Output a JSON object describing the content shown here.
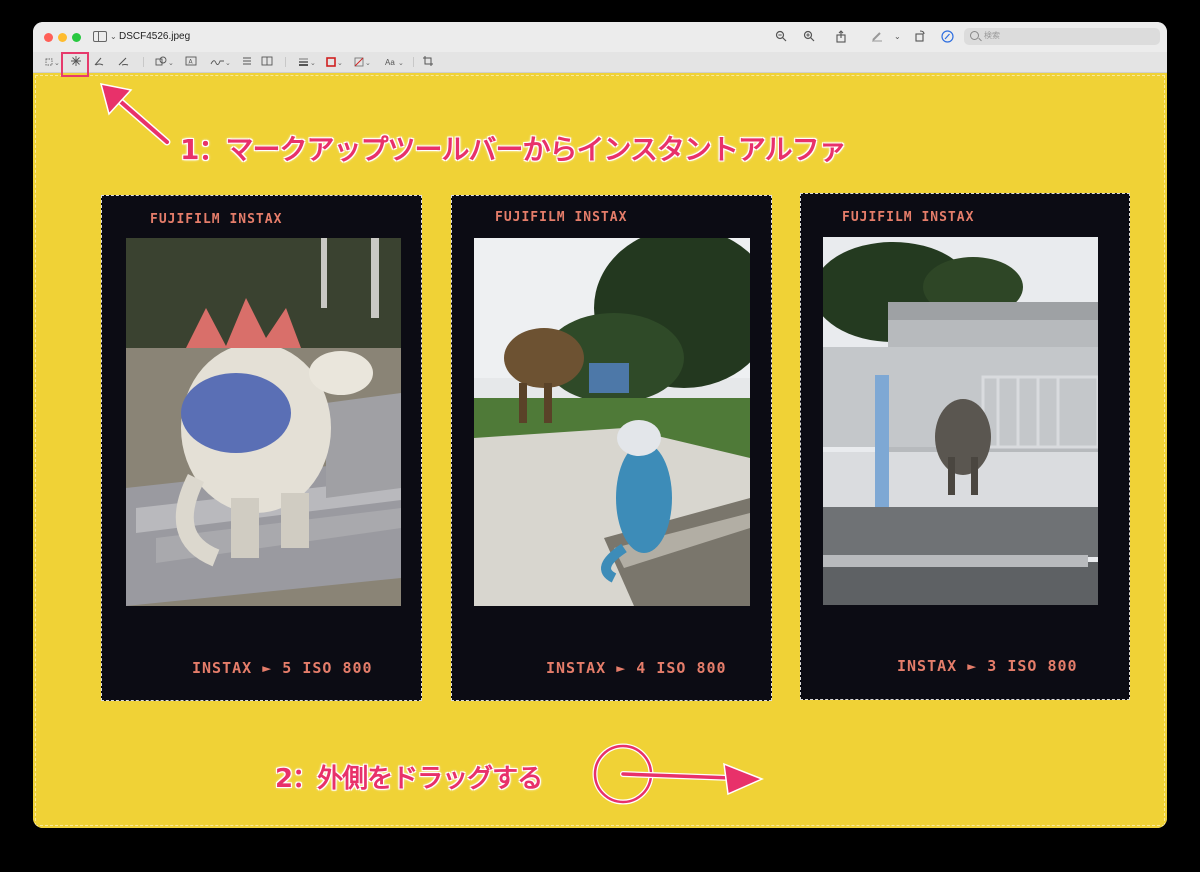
{
  "window": {
    "filename": "DSCF4526.jpeg",
    "search_placeholder": "検索"
  },
  "toolbar_icons": [
    "zoom-out-icon",
    "zoom-in-icon",
    "share-icon",
    "markup-pen-icon",
    "rotate-icon",
    "markup-toggle-icon"
  ],
  "markup_toolbar_icons": [
    "selection-rect-icon",
    "instant-alpha-icon",
    "sketch-icon",
    "draw-icon",
    "shapes-icon",
    "text-box-icon",
    "sign-icon",
    "note-icon",
    "adjust-color-icon",
    "shape-style-icon",
    "border-color-icon",
    "fill-color-icon",
    "text-style-icon",
    "crop-icon"
  ],
  "annotations": {
    "step1": "1：マークアップツールバーからインスタントアルファ",
    "step2": "2：外側をドラッグする"
  },
  "photos": [
    {
      "brand": "FUJIFILM INSTAX",
      "footer": "INSTAX ► 5 ISO 800",
      "subject": "stegosaurus-statue"
    },
    {
      "brand": "FUJIFILM INSTAX",
      "footer": "INSTAX ► 4 ISO 800",
      "subject": "t-rex-and-raptor-statues"
    },
    {
      "brand": "FUJIFILM INSTAX",
      "footer": "INSTAX ► 3 ISO 800",
      "subject": "elephant-enclosure"
    }
  ],
  "colors": {
    "canvas_background": "#f0d236",
    "annotation": "#e8316a",
    "film_text": "#e57d6a",
    "film_frame": "#0c0c14"
  }
}
